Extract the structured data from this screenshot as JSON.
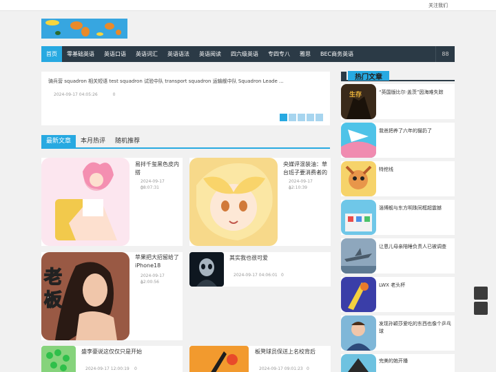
{
  "topbar": {
    "follow_label": "关注我们"
  },
  "nav": {
    "items": [
      "首页",
      "零基础英语",
      "英语口语",
      "英语词汇",
      "英语语法",
      "英语阅读",
      "四六级英语",
      "专四专八",
      "雅思",
      "BEC商务英语"
    ],
    "menu_icon": "88"
  },
  "slider": {
    "text": "骑兵营 squadron 相关短语 test squadron 试验中队 transport squadron 运输舰中队 Squadron Leade ...",
    "date": "2024-09-17 04:05:26",
    "count": "0"
  },
  "tabs": [
    "最新文章",
    "本月热评",
    "随机推荐"
  ],
  "cards": [
    {
      "title": "易拌千玺黑色皮内搭",
      "date": "2024-09-17 08:07:31",
      "count": "0"
    },
    {
      "title": "央媒评混装油：草台班子要消费者的",
      "date": "2024-09-17 12:10:39",
      "count": "0"
    },
    {
      "title": "苹果把大招留给了iPhone18",
      "date": "2024-09-17 12:00:56",
      "count": "0"
    },
    {
      "title": "其实我也很可爱",
      "date": "2024-09-17 04:06:01",
      "count": "0"
    },
    {
      "title": "盛李豪说这仅仅只是开始",
      "date": "2024-09-17 12:00:19",
      "count": "0"
    },
    {
      "title": "板凳球员保送上名校背后",
      "date": "2024-09-17 09:01:23",
      "count": "0"
    }
  ],
  "sidebar": {
    "title": "热门文章",
    "items": [
      "“英国版比尔·盖茨”因海难失踪",
      "我爸把养了六年的猫扔了",
      "特挖线",
      "淄博舰与东方明珠同框超震撼",
      "让恩儿母亲陪睡负责人已被调查",
      "LWX 老头杯",
      "发现孙颖莎爱吃的东西也像个乒乓球",
      "完美的她开播"
    ]
  },
  "colors": {
    "accent": "#27a9e1",
    "nav_bg": "#2b3a46"
  }
}
